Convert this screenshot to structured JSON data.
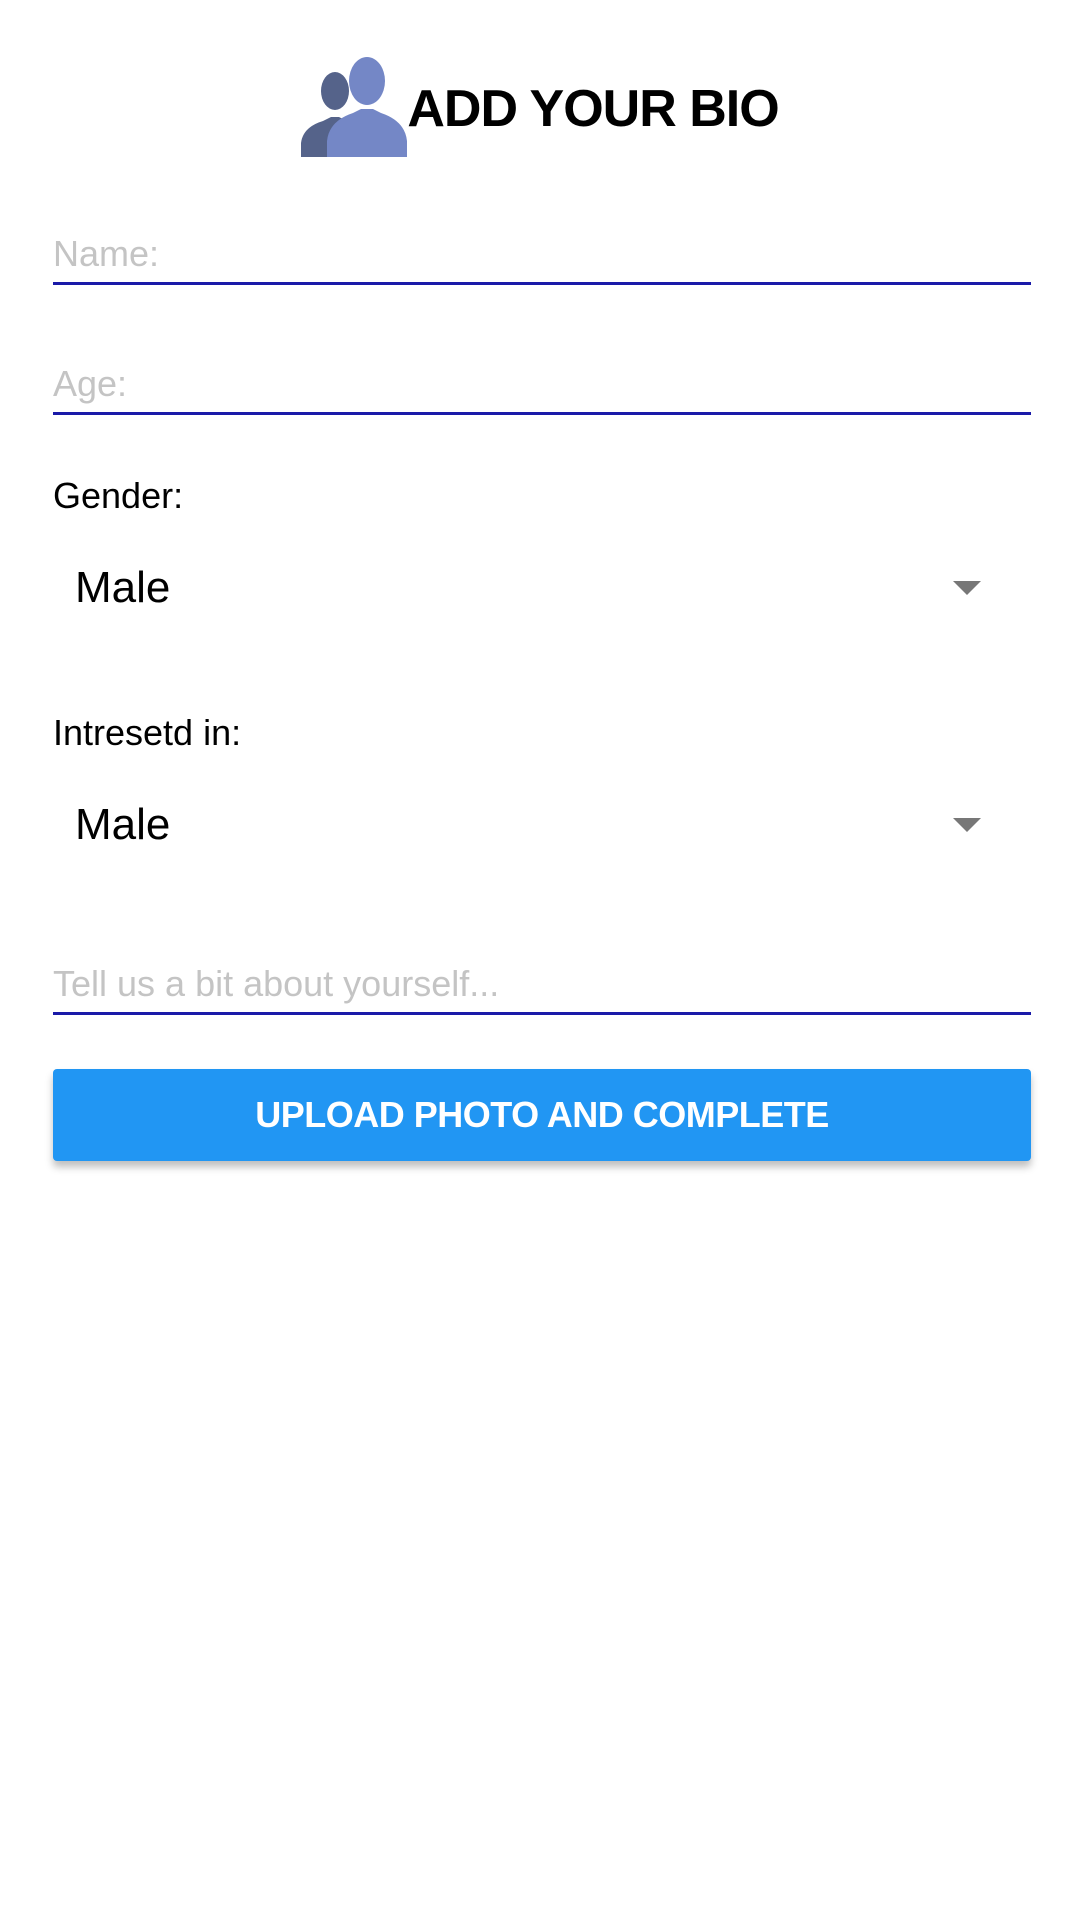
{
  "header": {
    "title": "ADD YOUR BIO",
    "icon": "users-icon",
    "icon_colors": [
      "#55638a",
      "#7487c6"
    ]
  },
  "form": {
    "name_placeholder": "Name:",
    "age_placeholder": "Age:",
    "gender_label": "Gender:",
    "gender_value": "Male",
    "interested_label": "Intresetd in:",
    "interested_value": "Male",
    "about_placeholder": "Tell us a bit about yourself..."
  },
  "actions": {
    "submit_label": "UPLOAD PHOTO AND COMPLETE"
  },
  "colors": {
    "accent": "#2196f3",
    "underline": "#1a1aa8",
    "placeholder": "#c4c4c4"
  }
}
